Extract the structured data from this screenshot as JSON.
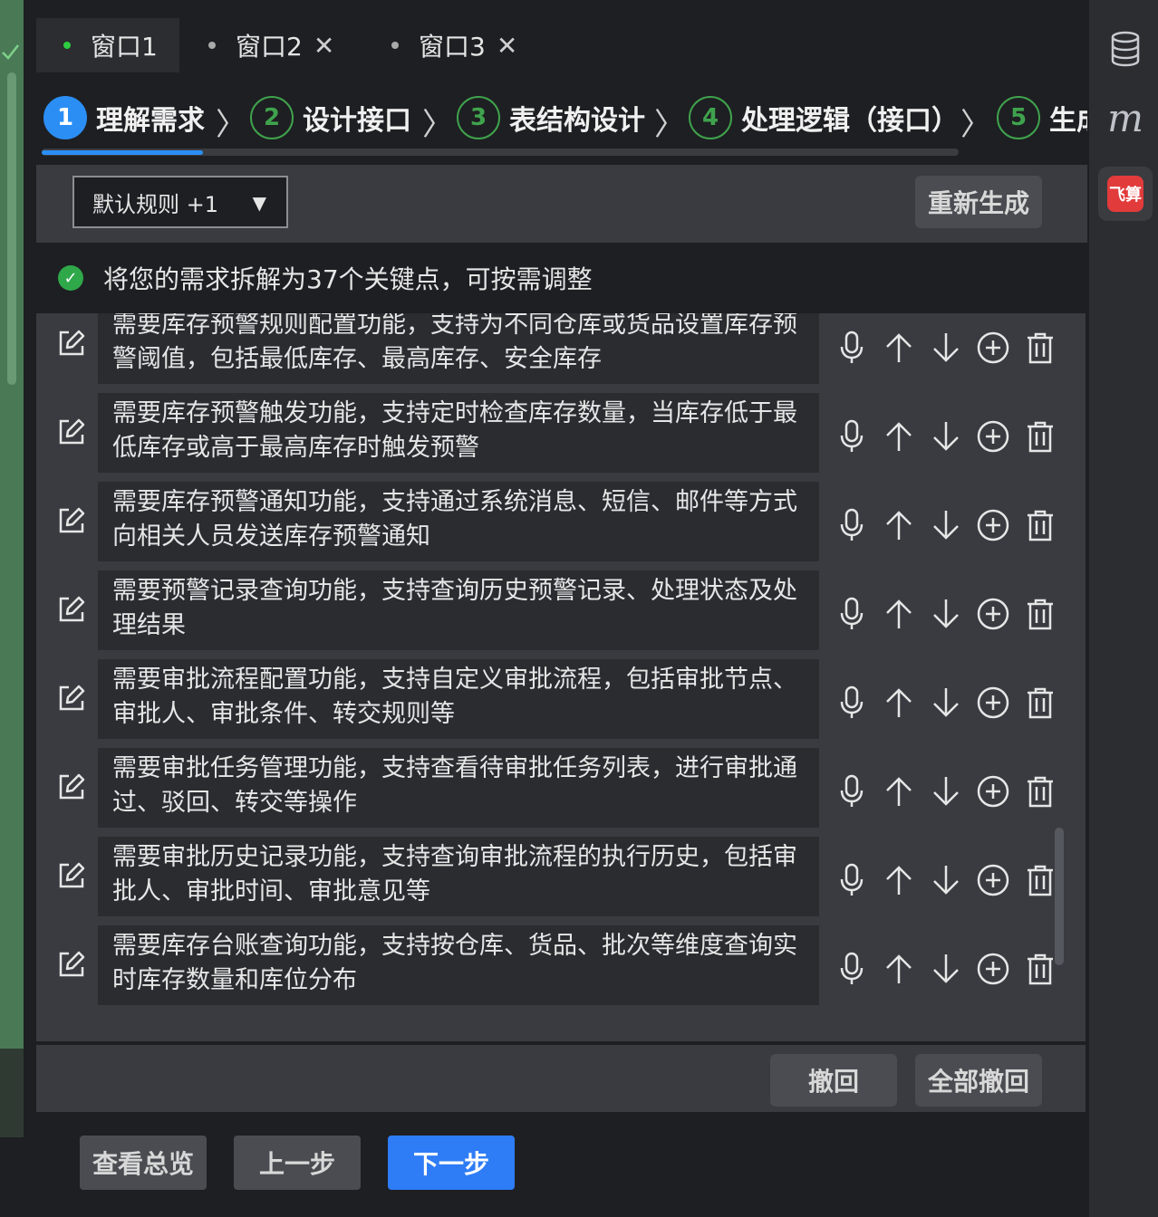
{
  "tabs": [
    {
      "label": "窗口1",
      "active": true,
      "closable": false
    },
    {
      "label": "窗口2",
      "active": false,
      "closable": true
    },
    {
      "label": "窗口3",
      "active": false,
      "closable": true
    }
  ],
  "steps": [
    {
      "num": "1",
      "label": "理解需求",
      "active": true
    },
    {
      "num": "2",
      "label": "设计接口"
    },
    {
      "num": "3",
      "label": "表结构设计"
    },
    {
      "num": "4",
      "label": "处理逻辑（接口）"
    },
    {
      "num": "5",
      "label": "生成"
    }
  ],
  "progress": {
    "fraction": 0.18
  },
  "toolbar": {
    "rule_select": "默认规则 +1",
    "regenerate": "重新生成"
  },
  "info": {
    "message": "将您的需求拆解为37个关键点，可按需调整"
  },
  "requirements": [
    "需要库存预警规则配置功能，支持为不同仓库或货品设置库存预警阈值，包括最低库存、最高库存、安全库存",
    "需要库存预警触发功能，支持定时检查库存数量，当库存低于最低库存或高于最高库存时触发预警",
    "需要库存预警通知功能，支持通过系统消息、短信、邮件等方式向相关人员发送库存预警通知",
    "需要预警记录查询功能，支持查询历史预警记录、处理状态及处理结果",
    "需要审批流程配置功能，支持自定义审批流程，包括审批节点、审批人、审批条件、转交规则等",
    "需要审批任务管理功能，支持查看待审批任务列表，进行审批通过、驳回、转交等操作",
    "需要审批历史记录功能，支持查询审批流程的执行历史，包括审批人、审批时间、审批意见等",
    "需要库存台账查询功能，支持按仓库、货品、批次等维度查询实时库存数量和库位分布"
  ],
  "actions": {
    "undo": "撤回",
    "undo_all": "全部撤回"
  },
  "footer": {
    "overview": "查看总览",
    "prev": "上一步",
    "next": "下一步"
  },
  "rightbar": {
    "m_icon": "m",
    "feishu": "飞算"
  },
  "colors": {
    "accent": "#2e7cf6",
    "success": "#2fa84a",
    "panel": "#393b40"
  }
}
